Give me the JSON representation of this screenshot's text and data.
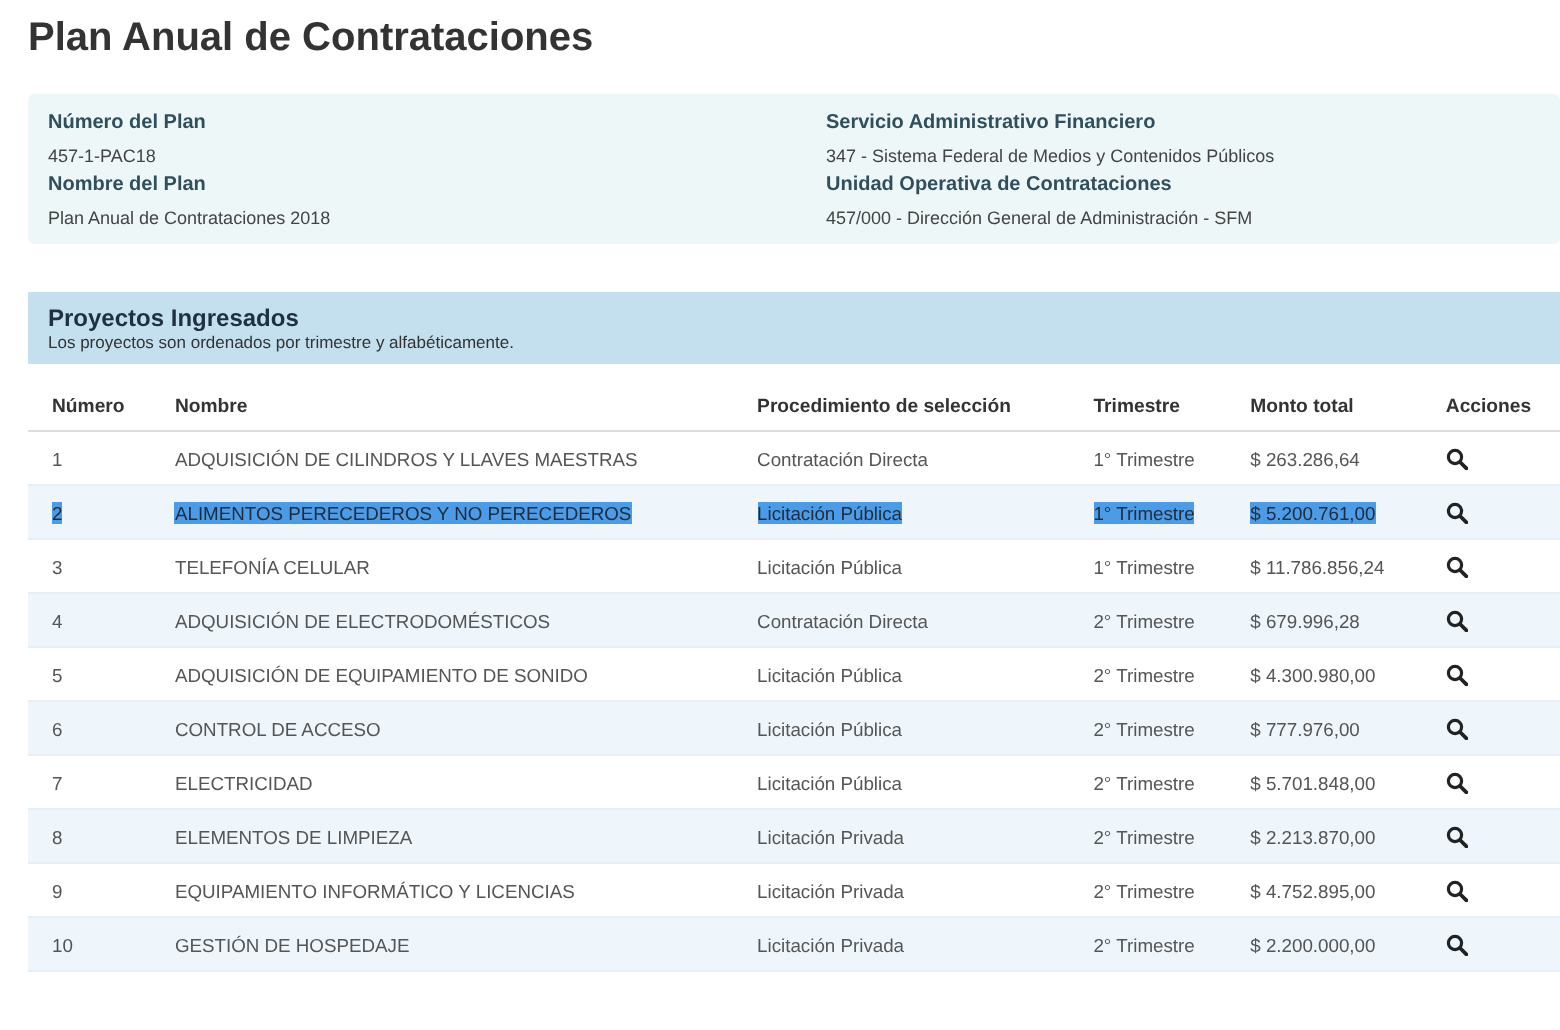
{
  "title": "Plan Anual de Contrataciones",
  "plan_info": [
    {
      "label": "Número del Plan",
      "value": "457-1-PAC18"
    },
    {
      "label": "Servicio Administrativo Financiero",
      "value": "347 - Sistema Federal de Medios y Contenidos Públicos"
    },
    {
      "label": "Nombre del Plan",
      "value": "Plan Anual de Contrataciones 2018"
    },
    {
      "label": "Unidad Operativa de Contrataciones",
      "value": "457/000 - Dirección General de Administración - SFM"
    }
  ],
  "section": {
    "title": "Proyectos Ingresados",
    "subtitle": "Los proyectos son ordenados por trimestre y alfabéticamente."
  },
  "table": {
    "columns": [
      "Número",
      "Nombre",
      "Procedimiento de selección",
      "Trimestre",
      "Monto total",
      "Acciones"
    ],
    "rows": [
      {
        "numero": "1",
        "nombre": "ADQUISICIÓN DE CILINDROS Y LLAVES MAESTRAS",
        "procedimiento": "Contratación Directa",
        "trimestre": "1° Trimestre",
        "monto": "$ 263.286,64",
        "selected": false
      },
      {
        "numero": "2",
        "nombre": "ALIMENTOS PERECEDEROS Y NO PERECEDEROS",
        "procedimiento": "Licitación Pública",
        "trimestre": "1° Trimestre",
        "monto": "$ 5.200.761,00",
        "selected": true
      },
      {
        "numero": "3",
        "nombre": "TELEFONÍA CELULAR",
        "procedimiento": "Licitación Pública",
        "trimestre": "1° Trimestre",
        "monto": "$ 11.786.856,24",
        "selected": false
      },
      {
        "numero": "4",
        "nombre": "ADQUISICIÓN DE ELECTRODOMÉSTICOS",
        "procedimiento": "Contratación Directa",
        "trimestre": "2° Trimestre",
        "monto": "$ 679.996,28",
        "selected": false
      },
      {
        "numero": "5",
        "nombre": "ADQUISICIÓN DE EQUIPAMIENTO DE SONIDO",
        "procedimiento": "Licitación Pública",
        "trimestre": "2° Trimestre",
        "monto": "$ 4.300.980,00",
        "selected": false
      },
      {
        "numero": "6",
        "nombre": "CONTROL DE ACCESO",
        "procedimiento": "Licitación Pública",
        "trimestre": "2° Trimestre",
        "monto": "$ 777.976,00",
        "selected": false
      },
      {
        "numero": "7",
        "nombre": "ELECTRICIDAD",
        "procedimiento": "Licitación Pública",
        "trimestre": "2° Trimestre",
        "monto": "$ 5.701.848,00",
        "selected": false
      },
      {
        "numero": "8",
        "nombre": "ELEMENTOS DE LIMPIEZA",
        "procedimiento": "Licitación Privada",
        "trimestre": "2° Trimestre",
        "monto": "$ 2.213.870,00",
        "selected": false
      },
      {
        "numero": "9",
        "nombre": "EQUIPAMIENTO INFORMÁTICO Y LICENCIAS",
        "procedimiento": "Licitación Privada",
        "trimestre": "2° Trimestre",
        "monto": "$ 4.752.895,00",
        "selected": false
      },
      {
        "numero": "10",
        "nombre": "GESTIÓN DE HOSPEDAJE",
        "procedimiento": "Licitación Privada",
        "trimestre": "2° Trimestre",
        "monto": "$ 2.200.000,00",
        "selected": false
      }
    ]
  }
}
